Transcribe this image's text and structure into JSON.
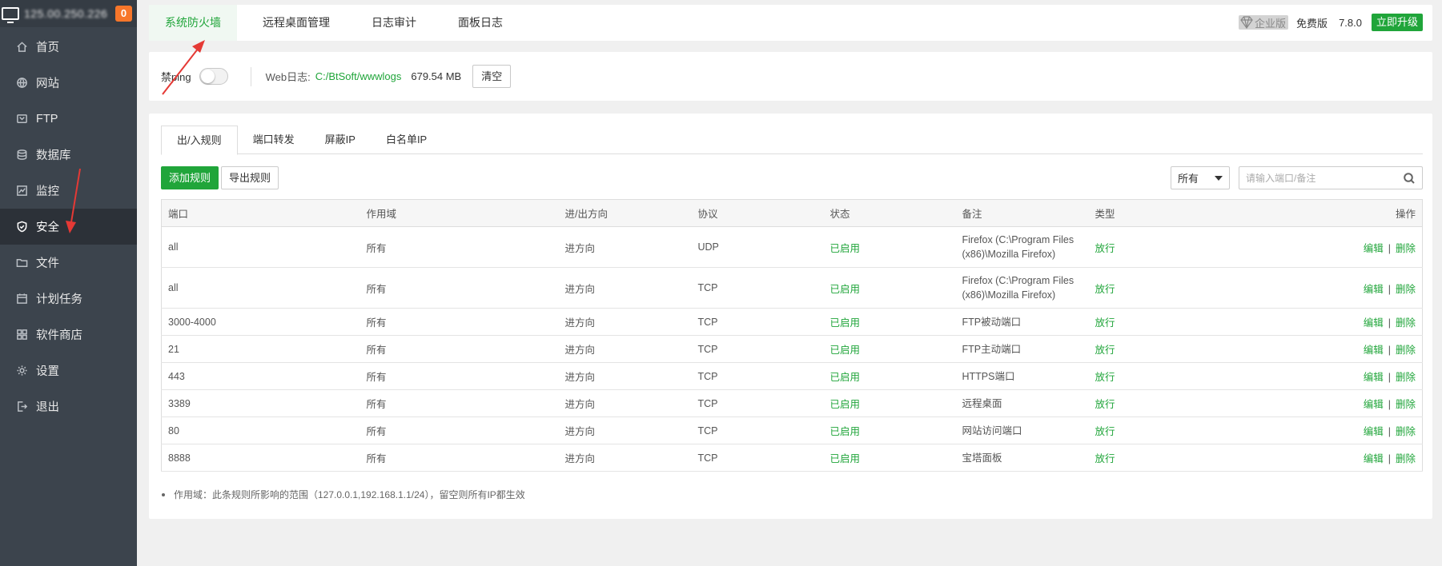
{
  "server": {
    "ip": "125.00.250.226",
    "notification_count": "0"
  },
  "sidebar": {
    "items": [
      {
        "label": "首页",
        "icon": "home-icon"
      },
      {
        "label": "网站",
        "icon": "globe-icon"
      },
      {
        "label": "FTP",
        "icon": "ftp-icon"
      },
      {
        "label": "数据库",
        "icon": "database-icon"
      },
      {
        "label": "监控",
        "icon": "monitor-icon"
      },
      {
        "label": "安全",
        "icon": "shield-icon",
        "active": true
      },
      {
        "label": "文件",
        "icon": "folder-icon"
      },
      {
        "label": "计划任务",
        "icon": "calendar-icon"
      },
      {
        "label": "软件商店",
        "icon": "apps-icon"
      },
      {
        "label": "设置",
        "icon": "gear-icon"
      },
      {
        "label": "退出",
        "icon": "logout-icon"
      }
    ]
  },
  "topbar": {
    "tabs": [
      {
        "label": "系统防火墙",
        "active": true
      },
      {
        "label": "远程桌面管理"
      },
      {
        "label": "日志审计"
      },
      {
        "label": "面板日志"
      }
    ],
    "enterprise": "企业版",
    "free": "免费版",
    "version": "7.8.0",
    "upgrade": "立即升级"
  },
  "controls": {
    "ping_label": "禁ping",
    "ping_enabled": false,
    "weblog_label": "Web日志:",
    "weblog_path": "C:/BtSoft/wwwlogs",
    "weblog_size": "679.54 MB",
    "clear_button": "清空"
  },
  "rules": {
    "tabs": [
      {
        "label": "出/入规则",
        "active": true
      },
      {
        "label": "端口转发"
      },
      {
        "label": "屏蔽IP"
      },
      {
        "label": "白名单IP"
      }
    ],
    "add_button": "添加规则",
    "export_button": "导出规则",
    "filter_selected": "所有",
    "search_placeholder": "请输入端口/备注",
    "columns": [
      "端口",
      "作用域",
      "进/出方向",
      "协议",
      "状态",
      "备注",
      "类型",
      "操作"
    ],
    "rows": [
      {
        "port": "all",
        "scope": "所有",
        "direction": "进方向",
        "protocol": "UDP",
        "status": "已启用",
        "remark1": "Firefox (C:\\Program Files",
        "remark2": "(x86)\\Mozilla Firefox)",
        "type": "放行"
      },
      {
        "port": "all",
        "scope": "所有",
        "direction": "进方向",
        "protocol": "TCP",
        "status": "已启用",
        "remark1": "Firefox (C:\\Program Files",
        "remark2": "(x86)\\Mozilla Firefox)",
        "type": "放行"
      },
      {
        "port": "3000-4000",
        "scope": "所有",
        "direction": "进方向",
        "protocol": "TCP",
        "status": "已启用",
        "remark1": "FTP被动端口",
        "remark2": "",
        "type": "放行"
      },
      {
        "port": "21",
        "scope": "所有",
        "direction": "进方向",
        "protocol": "TCP",
        "status": "已启用",
        "remark1": "FTP主动端口",
        "remark2": "",
        "type": "放行"
      },
      {
        "port": "443",
        "scope": "所有",
        "direction": "进方向",
        "protocol": "TCP",
        "status": "已启用",
        "remark1": "HTTPS端口",
        "remark2": "",
        "type": "放行"
      },
      {
        "port": "3389",
        "scope": "所有",
        "direction": "进方向",
        "protocol": "TCP",
        "status": "已启用",
        "remark1": "远程桌面",
        "remark2": "",
        "type": "放行"
      },
      {
        "port": "80",
        "scope": "所有",
        "direction": "进方向",
        "protocol": "TCP",
        "status": "已启用",
        "remark1": "网站访问端口",
        "remark2": "",
        "type": "放行"
      },
      {
        "port": "8888",
        "scope": "所有",
        "direction": "进方向",
        "protocol": "TCP",
        "status": "已启用",
        "remark1": "宝塔面板",
        "remark2": "",
        "type": "放行"
      }
    ],
    "edit_label": "编辑",
    "delete_label": "删除",
    "op_separator": "|",
    "footnote": "作用域：此条规则所影响的范围（127.0.0.1,192.168.1.1/24），留空则所有IP都生效"
  },
  "colors": {
    "accent": "#20a53a",
    "sidebar_bg": "#3c444d",
    "badge": "#f7762a",
    "annotation_arrow": "#e53935"
  }
}
